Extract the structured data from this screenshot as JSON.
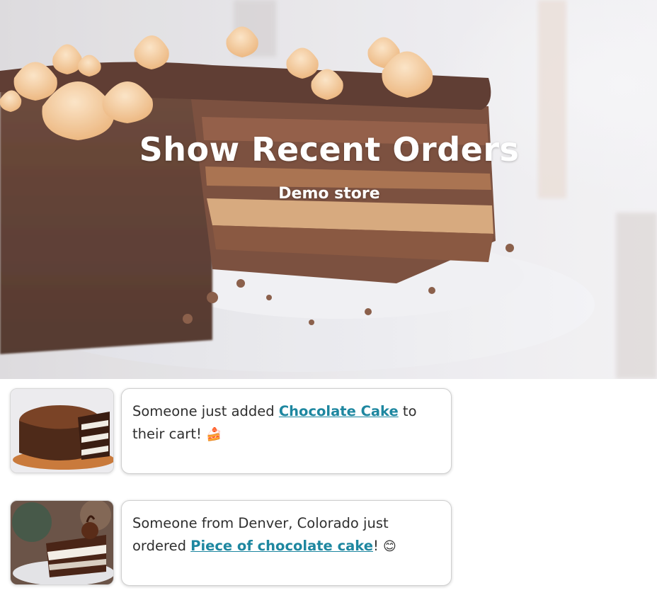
{
  "hero": {
    "title": "Show Recent Orders",
    "subtitle": "Demo store"
  },
  "notifications": [
    {
      "text_before": "Someone just added ",
      "product": "Chocolate Cake",
      "text_after": " to their cart! ",
      "emoji": "🍰",
      "thumbnail": "chocolate-cake-photo"
    },
    {
      "text_before": "Someone from Denver, Colorado just ordered ",
      "product": "Piece of chocolate cake",
      "text_after": "! ",
      "emoji": "😊",
      "thumbnail": "cake-slice-photo"
    }
  ],
  "colors": {
    "link": "#1e87a0",
    "text": "#2f2f2f",
    "hero_text": "#ffffff"
  }
}
